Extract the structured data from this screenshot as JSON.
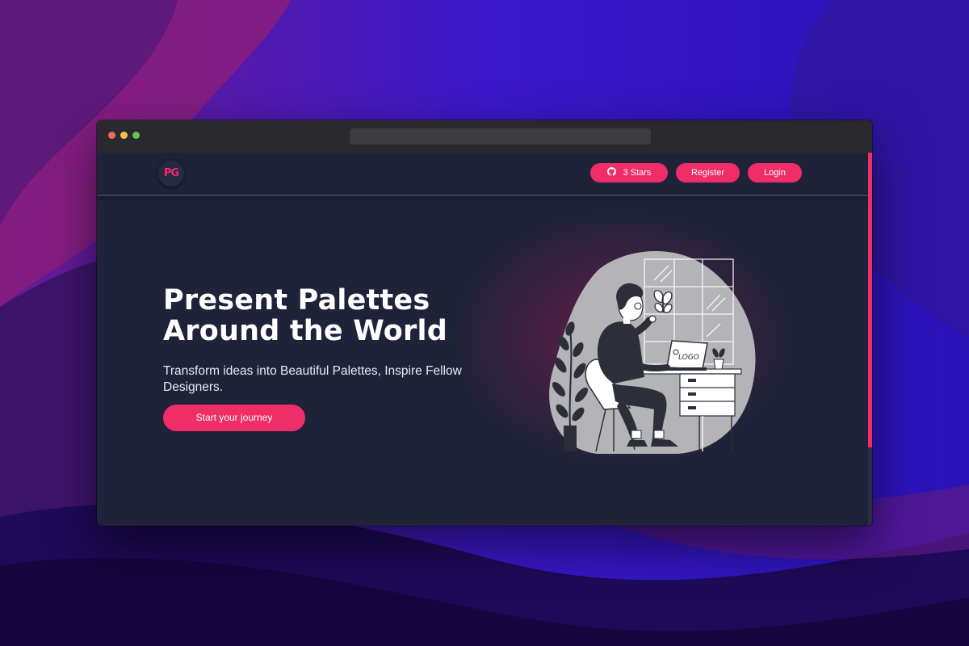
{
  "browser": {
    "address_bar_text": ""
  },
  "navbar": {
    "logo_text": "PG",
    "github_button": {
      "icon": "github-icon",
      "label": "3 Stars"
    },
    "register_label": "Register",
    "login_label": "Login"
  },
  "hero": {
    "title_line1": "Present Palettes",
    "title_line2": "Around the World",
    "subtitle": "Transform ideas into Beautiful Palettes, Inspire Fellow Designers.",
    "cta_label": "Start your journey",
    "illustration": {
      "icon": "designer-at-desk-illustration",
      "laptop_text": "LOGO"
    }
  },
  "colors": {
    "accent": "#ef2d68",
    "page_background": "#1f2339",
    "titlebar": "#2a2a2e"
  }
}
